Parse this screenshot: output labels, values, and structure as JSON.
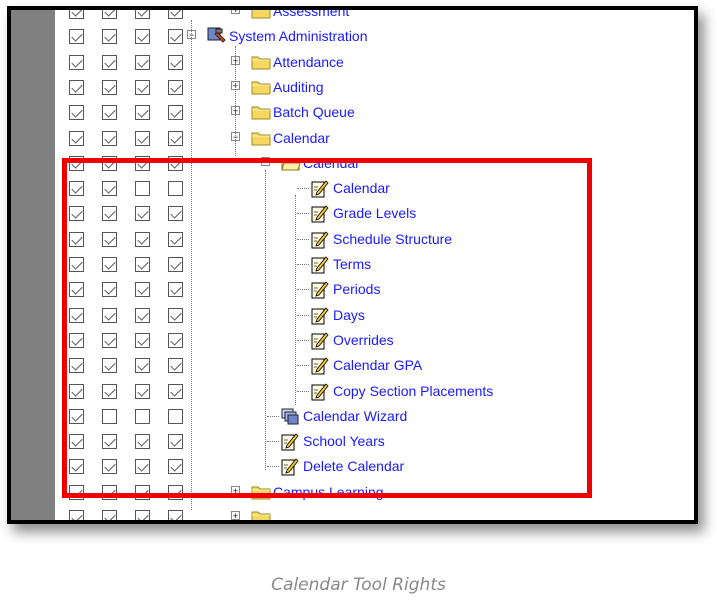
{
  "tree": {
    "rows": [
      {
        "label": "Assessment",
        "depth": 1,
        "icon": "folder",
        "toggle": "+",
        "checks": [
          1,
          1,
          1,
          1
        ]
      },
      {
        "label": "System Administration",
        "depth": 0,
        "icon": "tools",
        "toggle": "-",
        "checks": [
          1,
          1,
          1,
          1
        ]
      },
      {
        "label": "Attendance",
        "depth": 1,
        "icon": "folder",
        "toggle": "+",
        "checks": [
          1,
          1,
          1,
          1
        ]
      },
      {
        "label": "Auditing",
        "depth": 1,
        "icon": "folder",
        "toggle": "+",
        "checks": [
          1,
          1,
          1,
          1
        ]
      },
      {
        "label": "Batch Queue",
        "depth": 1,
        "icon": "folder",
        "toggle": "+",
        "checks": [
          1,
          1,
          1,
          1
        ]
      },
      {
        "label": "Calendar",
        "depth": 1,
        "icon": "folder",
        "toggle": "-",
        "checks": [
          1,
          1,
          1,
          1
        ]
      },
      {
        "label": "Calendar",
        "depth": 2,
        "icon": "folder-open",
        "toggle": "-",
        "checks": [
          1,
          1,
          1,
          1
        ]
      },
      {
        "label": "Calendar",
        "depth": 3,
        "icon": "page",
        "toggle": "",
        "checks": [
          1,
          1,
          0,
          0
        ]
      },
      {
        "label": "Grade Levels",
        "depth": 3,
        "icon": "page",
        "toggle": "",
        "checks": [
          1,
          1,
          1,
          1
        ]
      },
      {
        "label": "Schedule Structure",
        "depth": 3,
        "icon": "page",
        "toggle": "",
        "checks": [
          1,
          1,
          1,
          1
        ]
      },
      {
        "label": "Terms",
        "depth": 3,
        "icon": "page",
        "toggle": "",
        "checks": [
          1,
          1,
          1,
          1
        ]
      },
      {
        "label": "Periods",
        "depth": 3,
        "icon": "page",
        "toggle": "",
        "checks": [
          1,
          1,
          1,
          1
        ]
      },
      {
        "label": "Days",
        "depth": 3,
        "icon": "page",
        "toggle": "",
        "checks": [
          1,
          1,
          1,
          1
        ]
      },
      {
        "label": "Overrides",
        "depth": 3,
        "icon": "page",
        "toggle": "",
        "checks": [
          1,
          1,
          1,
          1
        ]
      },
      {
        "label": "Calendar GPA",
        "depth": 3,
        "icon": "page",
        "toggle": "",
        "checks": [
          1,
          1,
          1,
          1
        ]
      },
      {
        "label": "Copy Section Placements",
        "depth": 3,
        "icon": "page",
        "toggle": "",
        "checks": [
          1,
          1,
          1,
          1
        ]
      },
      {
        "label": "Calendar Wizard",
        "depth": 2,
        "icon": "wizard",
        "toggle": "",
        "checks": [
          1,
          0,
          0,
          0
        ]
      },
      {
        "label": "School Years",
        "depth": 2,
        "icon": "page",
        "toggle": "",
        "checks": [
          1,
          1,
          1,
          1
        ]
      },
      {
        "label": "Delete Calendar",
        "depth": 2,
        "icon": "page",
        "toggle": "",
        "checks": [
          1,
          1,
          1,
          1
        ]
      },
      {
        "label": "Campus Learning",
        "depth": 1,
        "icon": "folder",
        "toggle": "+",
        "checks": [
          1,
          1,
          1,
          1
        ]
      },
      {
        "label": "",
        "depth": 1,
        "icon": "folder",
        "toggle": "+",
        "checks": [
          1,
          1,
          1,
          1
        ]
      }
    ]
  },
  "caption": "Calendar Tool Rights",
  "colors": {
    "highlight": "#ee0000",
    "link": "#1a1aff",
    "folder": "#f6d860"
  }
}
